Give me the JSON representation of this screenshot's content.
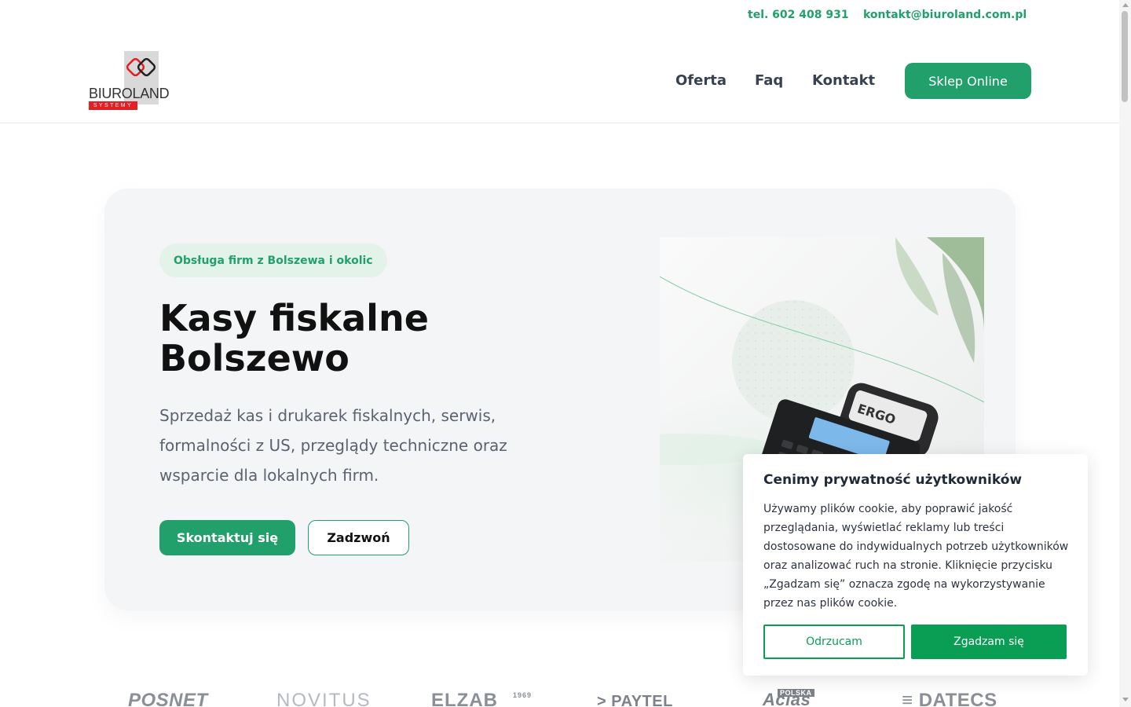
{
  "topbar": {
    "phone": "tel. 602 408 931",
    "email": "kontakt@biuroland.com.pl"
  },
  "header": {
    "logo_text": "BIUROLAND",
    "logo_sub": "SYSTEMY",
    "nav": [
      "Oferta",
      "Faq",
      "Kontakt"
    ],
    "shop_button": "Sklep Online"
  },
  "hero": {
    "badge": "Obsługa firm z Bolszewa i okolic",
    "title_line1": "Kasy fiskalne",
    "title_line2": "Bolszewo",
    "description": "Sprzedaż kas i drukarek fiskalnych, serwis, formalności z US, przeglądy techniczne oraz wsparcie dla lokalnych firm.",
    "contact_button": "Skontaktuj się",
    "call_button": "Zadzwoń",
    "device_brand": "ERGO"
  },
  "brands": {
    "posnet": "POSNET",
    "novitus": "NOVITUS",
    "elzab": "ELZAB",
    "elzab_year": "1969",
    "paytel": "PAYTEL",
    "aclas_badge": "POLSKA",
    "aclas": "Aclas",
    "datecs": "DATECS"
  },
  "cookie": {
    "title": "Cenimy prywatność użytkowników",
    "text": "Używamy plików cookie, aby poprawić jakość przeglądania, wyświetlać reklamy lub treści dostosowane do indywidualnych potrzeb użytkowników oraz analizować ruch na stronie. Kliknięcie przycisku „Zgadzam się” oznacza zgodę na wykorzystywanie przez nas plików cookie.",
    "reject": "Odrzucam",
    "accept": "Zgadzam się"
  },
  "colors": {
    "accent": "#22a06b",
    "cookie_accent": "#0a9e55",
    "logo_red": "#e31e24"
  }
}
